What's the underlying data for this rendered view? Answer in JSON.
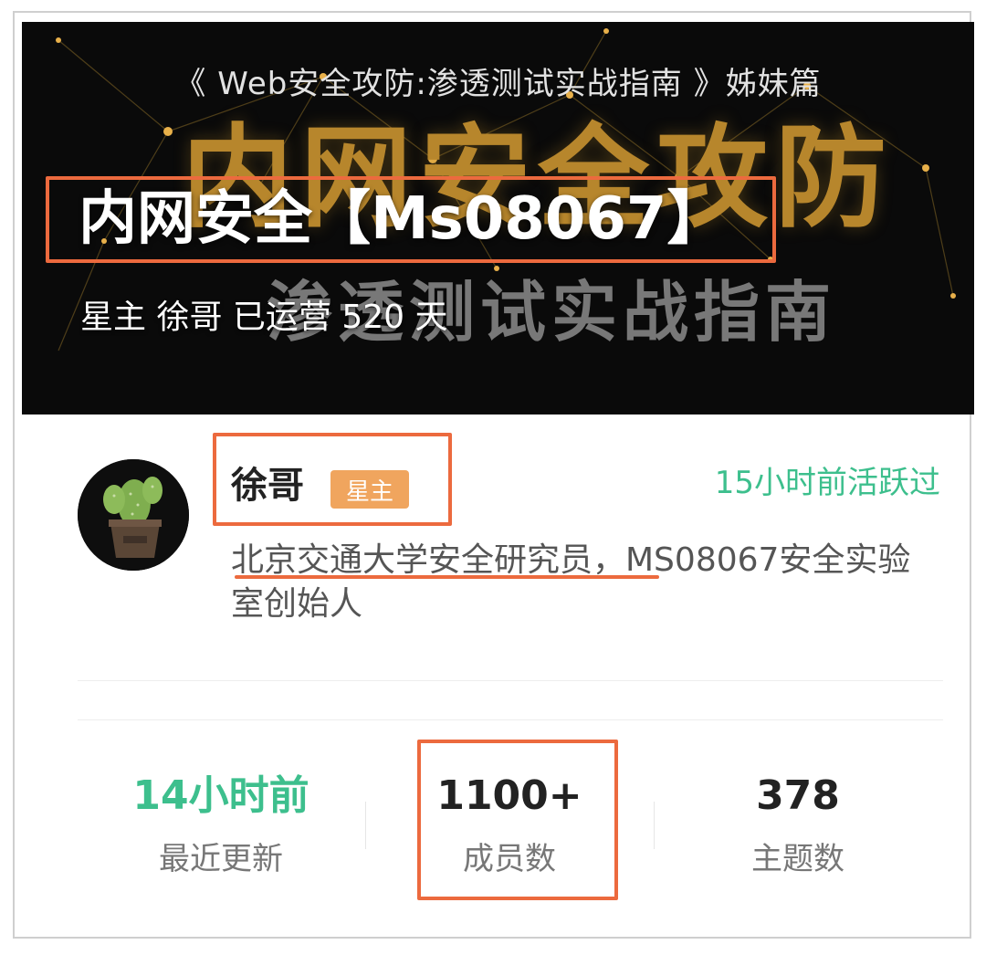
{
  "banner": {
    "subtitle": "《 Web安全攻防:渗透测试实战指南 》姊妹篇",
    "headline": "内网安全攻防",
    "headline2": "渗透测试实战指南"
  },
  "group": {
    "title": "内网安全【Ms08067】",
    "meta": "星主 徐哥 已运营 520 天"
  },
  "owner": {
    "name": "徐哥",
    "badge": "星主",
    "last_active": "15小时前活跃过",
    "bio": "北京交通大学安全研究员，MS08067安全实验室创始人"
  },
  "stats": [
    {
      "value": "14小时前",
      "label": "最近更新"
    },
    {
      "value": "1100+",
      "label": "成员数"
    },
    {
      "value": "378",
      "label": "主题数"
    }
  ],
  "colors": {
    "accent_green": "#3dbf8d",
    "highlight_orange": "#ec6a3e",
    "badge_orange": "#f0a55e",
    "banner_gold": "#b7862c"
  }
}
